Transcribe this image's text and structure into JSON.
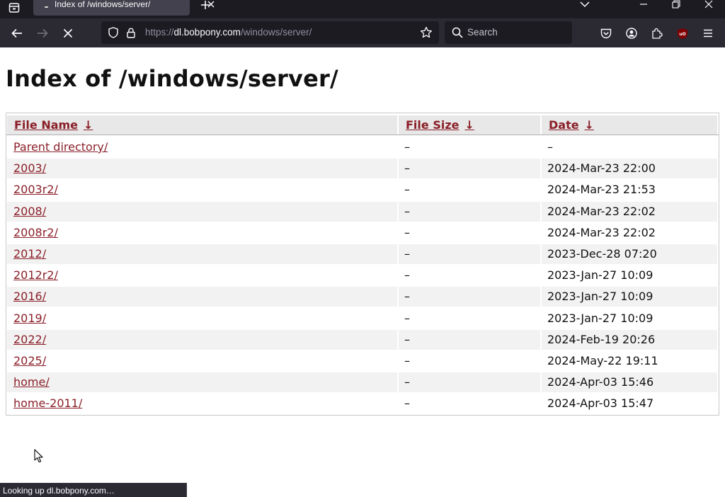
{
  "browser": {
    "tab": {
      "title": "Index of /windows/server/"
    },
    "url": {
      "prefix": "https://",
      "host": "dl.bobpony.com",
      "path": "/windows/server/"
    },
    "search_placeholder": "Search",
    "status_text": "Looking up dl.bobpony.com…"
  },
  "page": {
    "title": "Index of /windows/server/",
    "columns": [
      {
        "label": "File Name",
        "arrow": "↓"
      },
      {
        "label": "File Size",
        "arrow": "↓"
      },
      {
        "label": "Date",
        "arrow": "↓"
      }
    ],
    "rows": [
      {
        "name": "Parent directory/",
        "size": "–",
        "date": "–"
      },
      {
        "name": "2003/",
        "size": "–",
        "date": "2024-Mar-23 22:00"
      },
      {
        "name": "2003r2/",
        "size": "–",
        "date": "2024-Mar-23 21:53"
      },
      {
        "name": "2008/",
        "size": "–",
        "date": "2024-Mar-23 22:02"
      },
      {
        "name": "2008r2/",
        "size": "–",
        "date": "2024-Mar-23 22:02"
      },
      {
        "name": "2012/",
        "size": "–",
        "date": "2023-Dec-28 07:20"
      },
      {
        "name": "2012r2/",
        "size": "–",
        "date": "2023-Jan-27 10:09"
      },
      {
        "name": "2016/",
        "size": "–",
        "date": "2023-Jan-27 10:09"
      },
      {
        "name": "2019/",
        "size": "–",
        "date": "2023-Jan-27 10:09"
      },
      {
        "name": "2022/",
        "size": "–",
        "date": "2024-Feb-19 20:26"
      },
      {
        "name": "2025/",
        "size": "–",
        "date": "2024-May-22 19:11"
      },
      {
        "name": "home/",
        "size": "–",
        "date": "2024-Apr-03 15:46"
      },
      {
        "name": "home-2011/",
        "size": "–",
        "date": "2024-Apr-03 15:47"
      }
    ]
  },
  "colors": {
    "link": "#8a1f28",
    "chrome_dark": "#1c1b22",
    "toolbar": "#2b2a33",
    "row_alt": "#f2f2f2"
  },
  "icons": {
    "tab_list": "tab-list-icon",
    "close": "close-icon",
    "new_tab": "plus-icon",
    "back": "back-arrow-icon",
    "forward": "forward-arrow-icon",
    "stop": "stop-icon",
    "shield": "shield-icon",
    "lock": "lock-icon",
    "bookmark": "star-icon",
    "search": "search-icon",
    "pocket": "pocket-icon",
    "account": "account-icon",
    "extensions": "puzzle-icon",
    "ublock": "ublock-icon",
    "menu": "hamburger-menu-icon"
  }
}
